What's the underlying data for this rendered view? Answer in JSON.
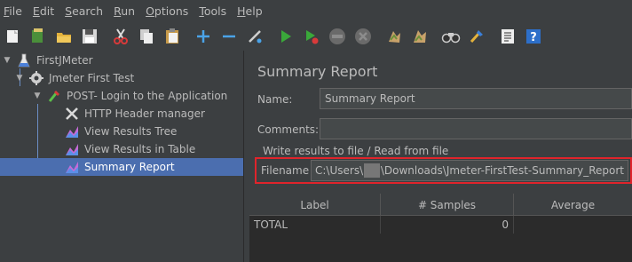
{
  "menu": [
    "File",
    "Edit",
    "Search",
    "Run",
    "Options",
    "Tools",
    "Help"
  ],
  "menu_mnemonics": [
    "F",
    "E",
    "S",
    "R",
    "O",
    "T",
    "H"
  ],
  "toolbar": [
    "new-icon",
    "templates-icon",
    "open-icon",
    "save-icon",
    "cut-icon",
    "copy-icon",
    "paste-icon",
    "expand-icon",
    "collapse-icon",
    "toggle-icon",
    "start-icon",
    "start-no-pause-icon",
    "stop-icon",
    "shutdown-icon",
    "clear-icon",
    "clear-all-icon",
    "search-icon",
    "reset-search-icon",
    "function-helper-icon",
    "help-icon"
  ],
  "tree": {
    "items": [
      {
        "label": "FirstJMeter",
        "icon": "flask-icon"
      },
      {
        "label": "Jmeter First Test",
        "icon": "gear-icon"
      },
      {
        "label": "POST- Login to the Application",
        "icon": "pipette-icon"
      },
      {
        "label": "HTTP Header manager",
        "icon": "wrench-icon"
      },
      {
        "label": "View Results Tree",
        "icon": "chart-icon"
      },
      {
        "label": "View Results in Table",
        "icon": "chart-icon"
      },
      {
        "label": "Summary Report",
        "icon": "chart-icon"
      }
    ]
  },
  "panel": {
    "title": "Summary Report",
    "name_label": "Name:",
    "name_value": "Summary Report",
    "comments_label": "Comments:",
    "comments_value": "",
    "write_results_label": "Write results to file / Read from file",
    "filename_label": "Filename",
    "filename_prefix": "C:\\Users\\",
    "filename_suffix": "\\Downloads\\Jmeter-FirstTest-Summary_Report"
  },
  "table": {
    "headers": [
      "Label",
      "# Samples",
      "Average"
    ],
    "rows": [
      {
        "label": "TOTAL",
        "samples": "0",
        "average": ""
      }
    ]
  }
}
